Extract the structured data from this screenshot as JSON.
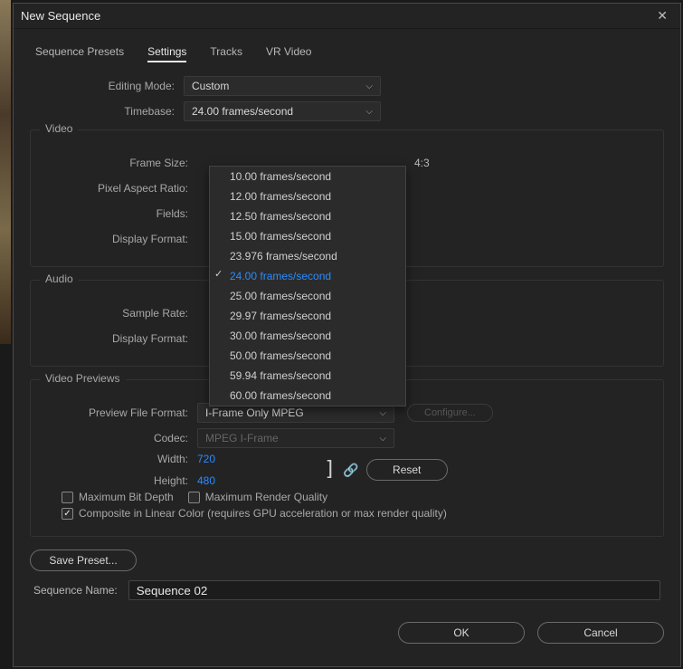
{
  "window": {
    "title": "New Sequence"
  },
  "tabs": [
    "Sequence Presets",
    "Settings",
    "Tracks",
    "VR Video"
  ],
  "active_tab": "Settings",
  "editing_mode": {
    "label": "Editing Mode:",
    "value": "Custom"
  },
  "timebase": {
    "label": "Timebase:",
    "value": "24.00  frames/second",
    "options": [
      "10.00  frames/second",
      "12.00  frames/second",
      "12.50  frames/second",
      "15.00  frames/second",
      "23.976  frames/second",
      "24.00  frames/second",
      "25.00  frames/second",
      "29.97  frames/second",
      "30.00  frames/second",
      "50.00  frames/second",
      "59.94  frames/second",
      "60.00  frames/second"
    ],
    "selected_index": 5
  },
  "video": {
    "section": "Video",
    "frame_size_label": "Frame Size:",
    "ratio": "4:3",
    "par_label": "Pixel Aspect Ratio:",
    "fields_label": "Fields:",
    "display_format_label": "Display Format:"
  },
  "audio": {
    "section": "Audio",
    "sample_rate_label": "Sample Rate:",
    "display_format_label": "Display Format:"
  },
  "previews": {
    "section": "Video Previews",
    "file_format_label": "Preview File Format:",
    "file_format_value": "I-Frame Only MPEG",
    "configure": "Configure...",
    "codec_label": "Codec:",
    "codec_value": "MPEG I-Frame",
    "width_label": "Width:",
    "width_value": "720",
    "height_label": "Height:",
    "height_value": "480",
    "reset": "Reset"
  },
  "checks": {
    "max_bit_depth": "Maximum Bit Depth",
    "max_render_quality": "Maximum Render Quality",
    "composite": "Composite in Linear Color (requires GPU acceleration or max render quality)",
    "composite_checked": true
  },
  "save_preset": "Save Preset...",
  "sequence_name": {
    "label": "Sequence Name:",
    "value": "Sequence 02"
  },
  "footer": {
    "ok": "OK",
    "cancel": "Cancel"
  }
}
